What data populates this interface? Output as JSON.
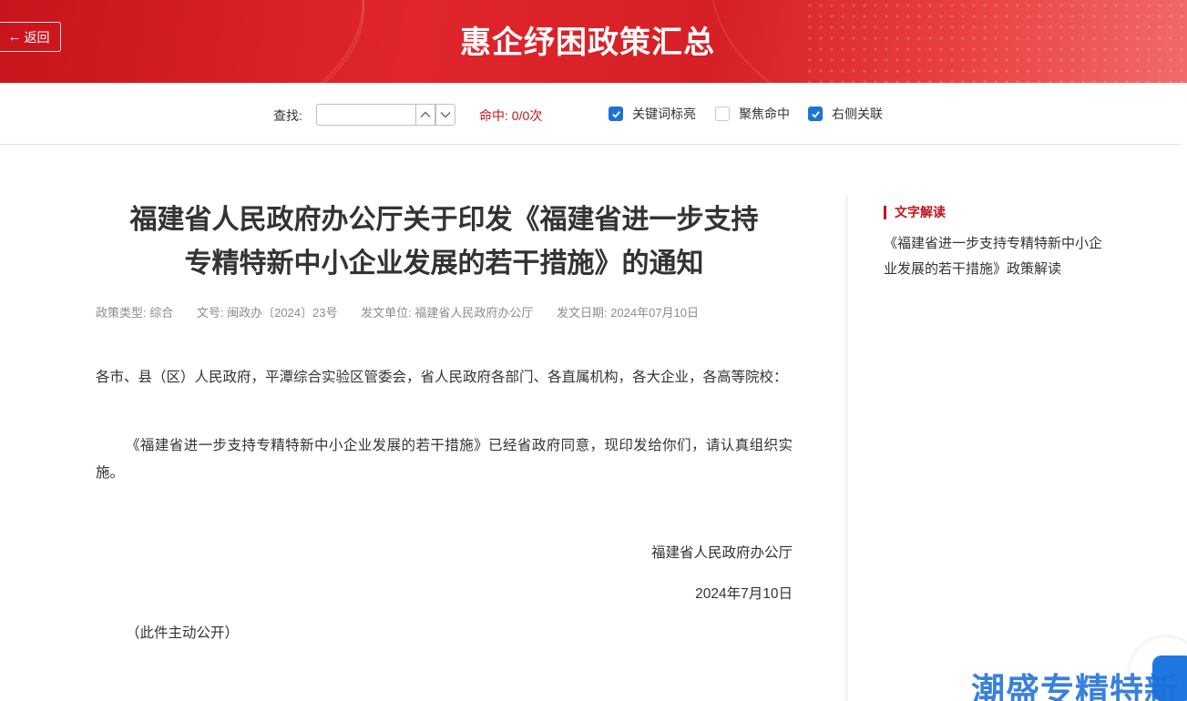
{
  "header": {
    "back_label": "返回",
    "title": "惠企纾困政策汇总"
  },
  "toolbar": {
    "search_label": "查找:",
    "search_value": "",
    "hit_label": "命中: 0/0次",
    "checkboxes": [
      {
        "label": "关键词标亮",
        "checked": true
      },
      {
        "label": "聚焦命中",
        "checked": false
      },
      {
        "label": "右侧关联",
        "checked": true
      }
    ]
  },
  "document": {
    "title_line1": "福建省人民政府办公厅关于印发《福建省进一步支持",
    "title_line2": "专精特新中小企业发展的若干措施》的通知",
    "meta": {
      "type": "政策类型: 综合",
      "doc_no": "文号: 闽政办〔2024〕23号",
      "issuer": "发文单位: 福建省人民政府办公厅",
      "date": "发文日期: 2024年07月10日"
    },
    "paragraph1": "各市、县（区）人民政府，平潭综合实验区管委会，省人民政府各部门、各直属机构，各大企业，各高等院校：",
    "paragraph2": "《福建省进一步支持专精特新中小企业发展的若干措施》已经省政府同意，现印发给你们，请认真组织实施。",
    "sign_org": "福建省人民政府办公厅",
    "sign_date": "2024年7月10日",
    "public_note": "（此件主动公开）"
  },
  "sidebar": {
    "title": "文字解读",
    "link": "《福建省进一步支持专精特新中小企业发展的若干措施》政策解读"
  },
  "watermark": {
    "text": "潮盛专精特新"
  },
  "colors": {
    "brand_red": "#c0141c",
    "checkbox_blue": "#1e73d4"
  }
}
